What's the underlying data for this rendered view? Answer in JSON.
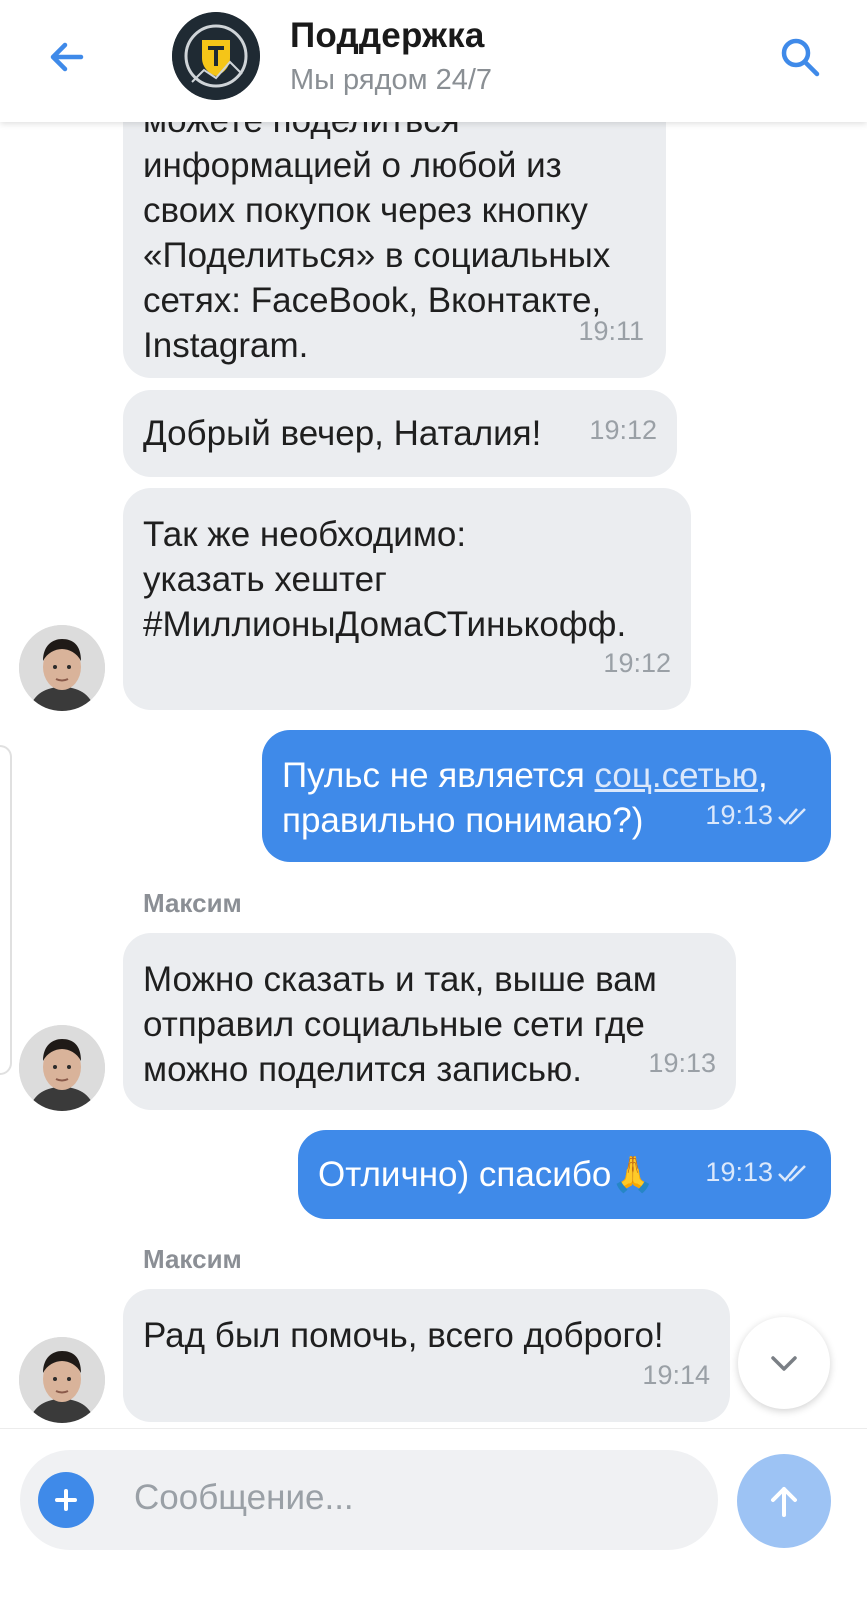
{
  "header": {
    "title": "Поддержка",
    "subtitle": "Мы рядом 24/7",
    "back_icon": "arrow-left-icon",
    "search_icon": "search-icon",
    "accent": "#3f8ae9"
  },
  "messages": [
    {
      "direction": "in",
      "lines": [
        "можете поделиться",
        "информацией о любой из",
        "своих покупок через кнопку",
        "«Поделиться» в социальных",
        "сетях: FaceBook, Вконтакте,",
        "Instagram."
      ],
      "time": "19:11"
    },
    {
      "direction": "in",
      "lines": [
        "Добрый вечер, Наталия!"
      ],
      "time": "19:12"
    },
    {
      "direction": "in",
      "lines": [
        "Так же необходимо:",
        "указать хештег",
        "#МиллионыДомаСТинькофф."
      ],
      "time": "19:12"
    },
    {
      "direction": "out",
      "text_before_link": "Пульс не является ",
      "link": "соц.сетью",
      "text_after_link": ",",
      "line2": "правильно понимаю?)",
      "time": "19:13"
    },
    {
      "direction": "in",
      "sender": "Максим",
      "lines": [
        "Можно сказать и так, выше вам",
        "отправил социальные сети где",
        "можно поделится записью."
      ],
      "time": "19:13"
    },
    {
      "direction": "out",
      "text": "Отлично) спасибо",
      "emoji": "🙏",
      "time": "19:13"
    },
    {
      "direction": "in",
      "sender": "Максим",
      "lines": [
        "Рад был помочь, всего доброго!"
      ],
      "time": "19:14"
    }
  ],
  "input": {
    "placeholder": "Сообщение..."
  }
}
